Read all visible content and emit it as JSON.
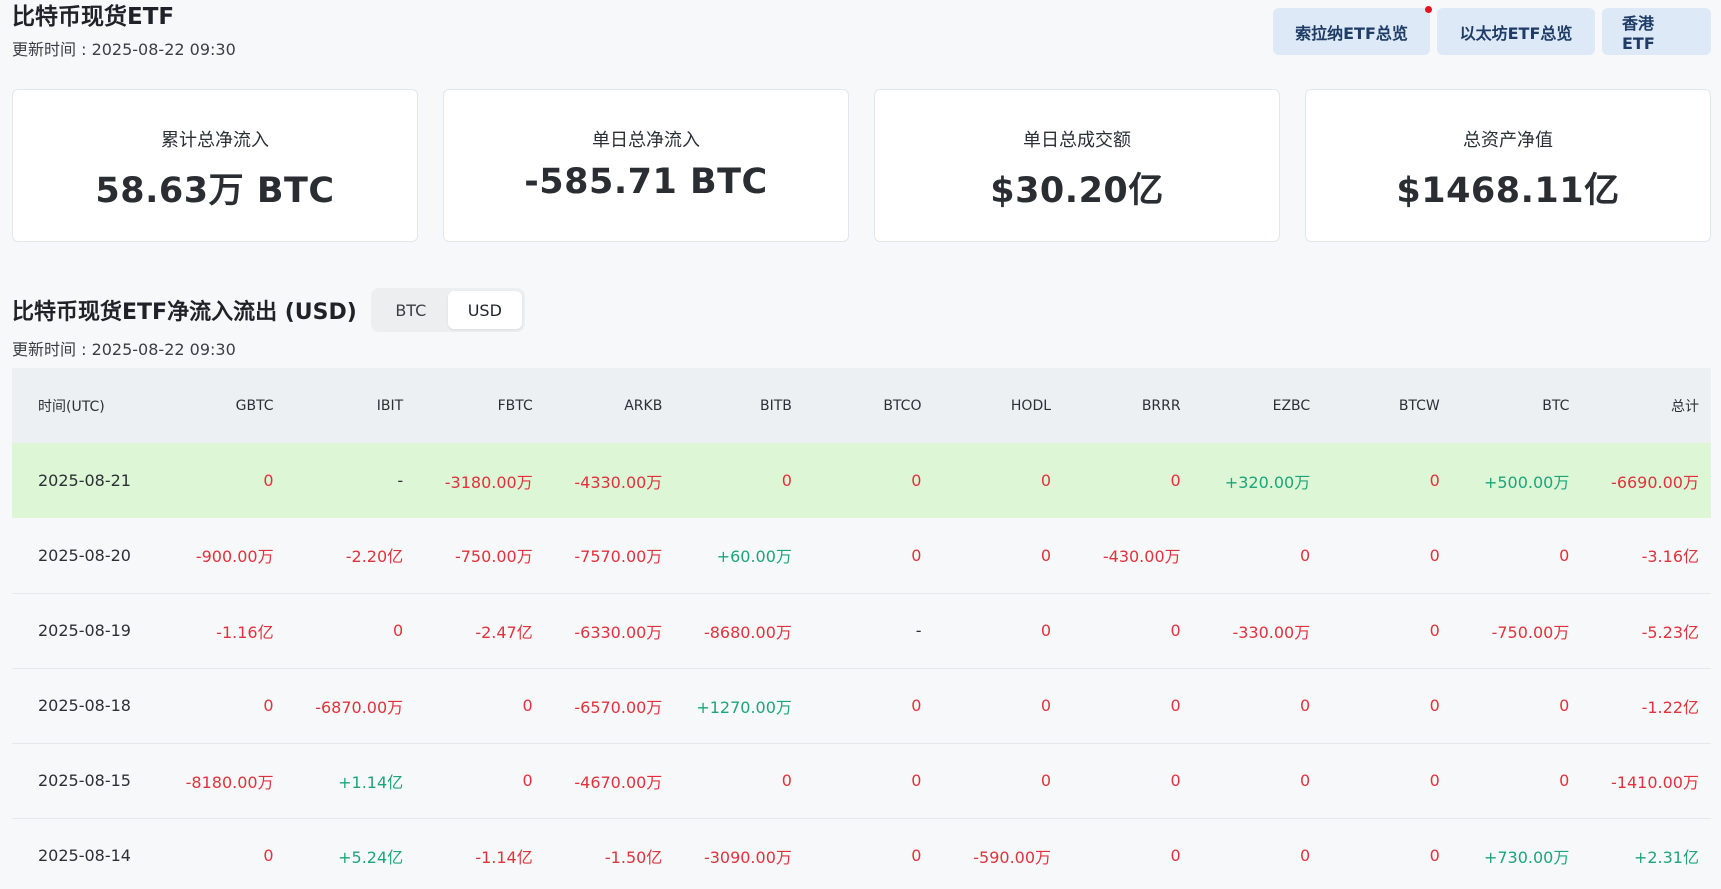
{
  "header": {
    "title": "比特币现货ETF",
    "updated": "更新时间 : 2025-08-22 09:30"
  },
  "top_nav": {
    "items": [
      {
        "label": "索拉纳ETF总览",
        "has_dot": true
      },
      {
        "label": "以太坊ETF总览",
        "has_dot": false
      },
      {
        "label": "香港 ETF",
        "has_dot": false
      }
    ]
  },
  "cards": [
    {
      "label": "累计总净流入",
      "value": "58.63万 BTC"
    },
    {
      "label": "单日总净流入",
      "value": "-585.71 BTC"
    },
    {
      "label": "单日总成交额",
      "value": "$30.20亿"
    },
    {
      "label": "总资产净值",
      "value": "$1468.11亿"
    }
  ],
  "section": {
    "title": "比特币现货ETF净流入流出 (USD)",
    "updated": "更新时间 : 2025-08-22 09:30",
    "toggle": {
      "options": [
        "BTC",
        "USD"
      ],
      "selected": "USD"
    }
  },
  "table": {
    "columns": [
      "时间(UTC)",
      "GBTC",
      "IBIT",
      "FBTC",
      "ARKB",
      "BITB",
      "BTCO",
      "HODL",
      "BRRR",
      "EZBC",
      "BTCW",
      "BTC",
      "总计"
    ],
    "rows": [
      {
        "highlight": true,
        "cells": [
          {
            "v": "2025-08-21",
            "t": "date"
          },
          {
            "v": "0",
            "t": "neg"
          },
          {
            "v": "-",
            "t": "dash"
          },
          {
            "v": "-3180.00万",
            "t": "neg"
          },
          {
            "v": "-4330.00万",
            "t": "neg"
          },
          {
            "v": "0",
            "t": "neg"
          },
          {
            "v": "0",
            "t": "neg"
          },
          {
            "v": "0",
            "t": "neg"
          },
          {
            "v": "0",
            "t": "neg"
          },
          {
            "v": "+320.00万",
            "t": "pos"
          },
          {
            "v": "0",
            "t": "neg"
          },
          {
            "v": "+500.00万",
            "t": "pos"
          },
          {
            "v": "-6690.00万",
            "t": "neg"
          }
        ]
      },
      {
        "highlight": false,
        "cells": [
          {
            "v": "2025-08-20",
            "t": "date"
          },
          {
            "v": "-900.00万",
            "t": "neg"
          },
          {
            "v": "-2.20亿",
            "t": "neg"
          },
          {
            "v": "-750.00万",
            "t": "neg"
          },
          {
            "v": "-7570.00万",
            "t": "neg"
          },
          {
            "v": "+60.00万",
            "t": "pos"
          },
          {
            "v": "0",
            "t": "neg"
          },
          {
            "v": "0",
            "t": "neg"
          },
          {
            "v": "-430.00万",
            "t": "neg"
          },
          {
            "v": "0",
            "t": "neg"
          },
          {
            "v": "0",
            "t": "neg"
          },
          {
            "v": "0",
            "t": "neg"
          },
          {
            "v": "-3.16亿",
            "t": "neg"
          }
        ]
      },
      {
        "highlight": false,
        "cells": [
          {
            "v": "2025-08-19",
            "t": "date"
          },
          {
            "v": "-1.16亿",
            "t": "neg"
          },
          {
            "v": "0",
            "t": "neg"
          },
          {
            "v": "-2.47亿",
            "t": "neg"
          },
          {
            "v": "-6330.00万",
            "t": "neg"
          },
          {
            "v": "-8680.00万",
            "t": "neg"
          },
          {
            "v": "-",
            "t": "dash"
          },
          {
            "v": "0",
            "t": "neg"
          },
          {
            "v": "0",
            "t": "neg"
          },
          {
            "v": "-330.00万",
            "t": "neg"
          },
          {
            "v": "0",
            "t": "neg"
          },
          {
            "v": "-750.00万",
            "t": "neg"
          },
          {
            "v": "-5.23亿",
            "t": "neg"
          }
        ]
      },
      {
        "highlight": false,
        "cells": [
          {
            "v": "2025-08-18",
            "t": "date"
          },
          {
            "v": "0",
            "t": "neg"
          },
          {
            "v": "-6870.00万",
            "t": "neg"
          },
          {
            "v": "0",
            "t": "neg"
          },
          {
            "v": "-6570.00万",
            "t": "neg"
          },
          {
            "v": "+1270.00万",
            "t": "pos"
          },
          {
            "v": "0",
            "t": "neg"
          },
          {
            "v": "0",
            "t": "neg"
          },
          {
            "v": "0",
            "t": "neg"
          },
          {
            "v": "0",
            "t": "neg"
          },
          {
            "v": "0",
            "t": "neg"
          },
          {
            "v": "0",
            "t": "neg"
          },
          {
            "v": "-1.22亿",
            "t": "neg"
          }
        ]
      },
      {
        "highlight": false,
        "cells": [
          {
            "v": "2025-08-15",
            "t": "date"
          },
          {
            "v": "-8180.00万",
            "t": "neg"
          },
          {
            "v": "+1.14亿",
            "t": "pos"
          },
          {
            "v": "0",
            "t": "neg"
          },
          {
            "v": "-4670.00万",
            "t": "neg"
          },
          {
            "v": "0",
            "t": "neg"
          },
          {
            "v": "0",
            "t": "neg"
          },
          {
            "v": "0",
            "t": "neg"
          },
          {
            "v": "0",
            "t": "neg"
          },
          {
            "v": "0",
            "t": "neg"
          },
          {
            "v": "0",
            "t": "neg"
          },
          {
            "v": "0",
            "t": "neg"
          },
          {
            "v": "-1410.00万",
            "t": "neg"
          }
        ]
      },
      {
        "highlight": false,
        "cells": [
          {
            "v": "2025-08-14",
            "t": "date"
          },
          {
            "v": "0",
            "t": "neg"
          },
          {
            "v": "+5.24亿",
            "t": "pos"
          },
          {
            "v": "-1.14亿",
            "t": "neg"
          },
          {
            "v": "-1.50亿",
            "t": "neg"
          },
          {
            "v": "-3090.00万",
            "t": "neg"
          },
          {
            "v": "0",
            "t": "neg"
          },
          {
            "v": "-590.00万",
            "t": "neg"
          },
          {
            "v": "0",
            "t": "neg"
          },
          {
            "v": "0",
            "t": "neg"
          },
          {
            "v": "0",
            "t": "neg"
          },
          {
            "v": "+730.00万",
            "t": "pos"
          },
          {
            "v": "+2.31亿",
            "t": "pos"
          }
        ]
      }
    ]
  },
  "colors": {
    "negative": "#e0323d",
    "positive": "#1da57a",
    "highlight_row": "#dcf6d6",
    "nav_button_bg": "#dde9f6",
    "notification_dot": "#e5131d"
  }
}
